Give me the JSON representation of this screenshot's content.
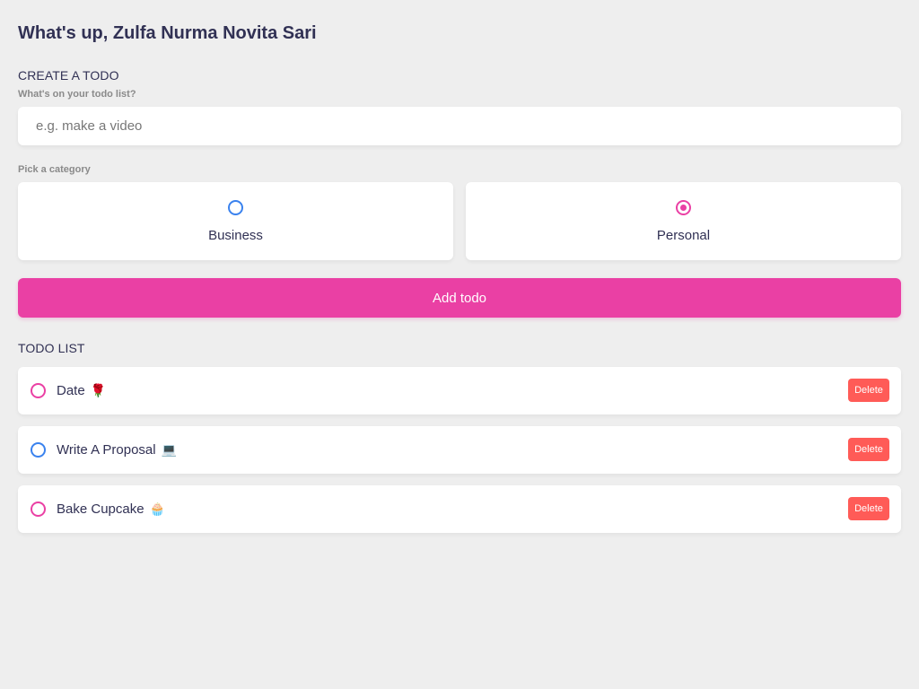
{
  "greeting": "What's up, Zulfa Nurma Novita Sari",
  "create": {
    "title": "CREATE A TODO",
    "input_label": "What's on your todo list?",
    "input_placeholder": "e.g. make a video",
    "input_value": "",
    "category_label": "Pick a category",
    "categories": [
      {
        "label": "Business",
        "selected": false,
        "color": "#3a82ee"
      },
      {
        "label": "Personal",
        "selected": true,
        "color": "#ea40a4"
      }
    ],
    "add_button_label": "Add todo"
  },
  "list": {
    "title": "TODO LIST",
    "delete_label": "Delete",
    "items": [
      {
        "text": "Date",
        "emoji": "🌹",
        "category": "personal",
        "done": false
      },
      {
        "text": "Write A Proposal",
        "emoji": "💻",
        "category": "business",
        "done": false
      },
      {
        "text": "Bake Cupcake",
        "emoji": "🧁",
        "category": "personal",
        "done": false
      }
    ]
  },
  "colors": {
    "accent": "#ea40a4",
    "business": "#3a82ee",
    "delete": "#ff5b57",
    "background": "#eeeeee"
  }
}
